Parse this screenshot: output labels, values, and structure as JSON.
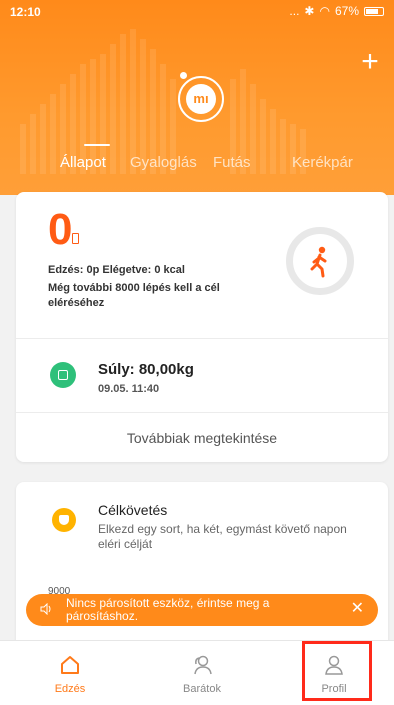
{
  "status_bar": {
    "time": "12:10",
    "battery": "67%",
    "signal_text": "..."
  },
  "header": {
    "logo_text": "mı"
  },
  "tabs": [
    {
      "label": "Állapot",
      "active": true
    },
    {
      "label": "Gyaloglás",
      "active": false
    },
    {
      "label": "Futás",
      "active": false
    },
    {
      "label": "Kerékpár",
      "active": false
    }
  ],
  "summary": {
    "steps": "0",
    "line1": "Edzés: 0p Elégetve: 0 kcal",
    "line2": "Még további 8000 lépés kell a cél eléréséhez"
  },
  "weight": {
    "title": "Súly: 80,00kg",
    "date": "09.05. 11:40"
  },
  "more_label": "Továbbiak megtekintése",
  "goal": {
    "title": "Célkövetés",
    "description": "Elkezd egy sort, ha két, egymást követő napon eléri célját",
    "axis_value": "9000"
  },
  "toast": {
    "message": "Nincs párosított eszköz, érintse meg a párosításhoz."
  },
  "bottom_nav": [
    {
      "label": "Edzés",
      "icon": "home-icon",
      "active": true
    },
    {
      "label": "Barátok",
      "icon": "friends-icon",
      "active": false
    },
    {
      "label": "Profil",
      "icon": "profile-icon",
      "active": false
    }
  ],
  "colors": {
    "accent": "#ff8a1a",
    "steps": "#ff5b14",
    "weight_icon": "#2ec07a",
    "goal_icon": "#ffb300",
    "highlight": "#ff2a1a"
  }
}
